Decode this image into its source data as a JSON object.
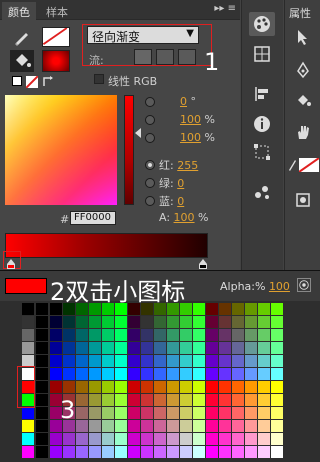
{
  "tabs": {
    "color": "颜色",
    "swatches": "样本",
    "menu_glyph": "▸▸ ≡"
  },
  "props_title": "属性",
  "fill_type": {
    "value": "径向渐变",
    "label": "流:"
  },
  "linear_rgb": {
    "label": "线性 RGB"
  },
  "hsb": [
    {
      "value": "0",
      "unit": "°"
    },
    {
      "value": "100",
      "unit": "%"
    },
    {
      "value": "100",
      "unit": "%"
    }
  ],
  "rgb": [
    {
      "label": "红:",
      "value": "255"
    },
    {
      "label": "绿:",
      "value": "0"
    },
    {
      "label": "蓝:",
      "value": "0"
    }
  ],
  "alpha": {
    "label": "A:",
    "value": "100",
    "unit": "%"
  },
  "hex": {
    "prefix": "#",
    "value": "FF0000"
  },
  "swatch_bar": {
    "alpha_label": "Alpha:%",
    "alpha_value": "100"
  },
  "annotations": {
    "one": "1",
    "two": "2双击小图标",
    "three": "3"
  },
  "colors": {
    "accent": "#ff0000",
    "orange": "#e0a030",
    "annot": "#e02020"
  }
}
